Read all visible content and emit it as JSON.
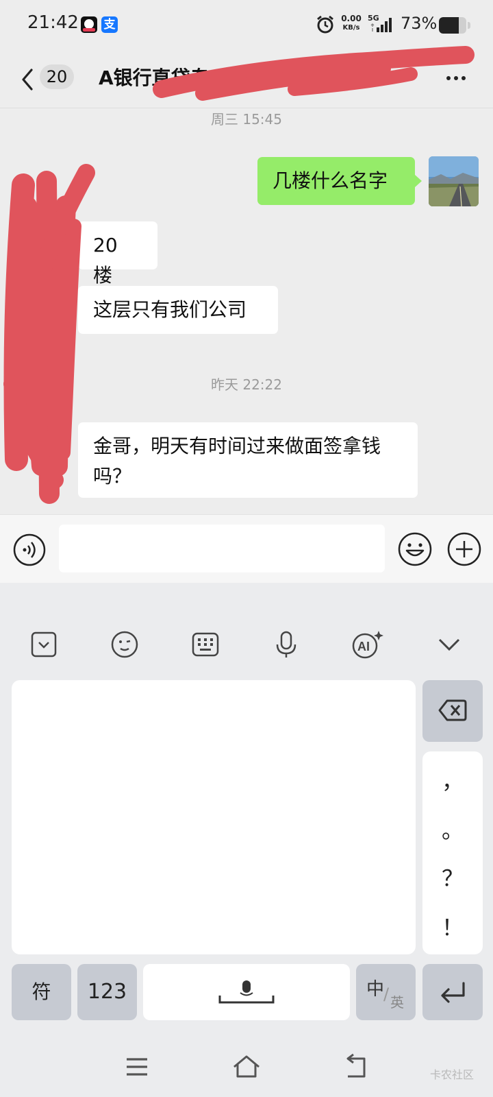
{
  "status_bar": {
    "time": "21:42",
    "alipay_icon_char": "支",
    "net_speed": "0.00",
    "net_unit": "KB/s",
    "network_type": "5G",
    "battery_percent": "73%",
    "battery_level": 0.73
  },
  "header": {
    "unread_count": "20",
    "title": "A银行直贷专"
  },
  "messages": [
    {
      "type": "timestamp",
      "text": "周三 15:45"
    },
    {
      "type": "outgoing",
      "text": "几楼什么名字"
    },
    {
      "type": "incoming",
      "text": "20 楼"
    },
    {
      "type": "incoming",
      "text": "这层只有我们公司"
    },
    {
      "type": "timestamp",
      "text": "昨天 22:22"
    },
    {
      "type": "incoming",
      "text": "金哥，明天有时间过来做面签拿钱吗？"
    }
  ],
  "input": {
    "value": "",
    "placeholder": ""
  },
  "keyboard": {
    "punctuation": [
      "，",
      "。",
      "？",
      "！"
    ],
    "symbol_key": "符",
    "number_key": "123",
    "lang_primary": "中",
    "lang_secondary": "英"
  },
  "watermark": "卡农社区",
  "colors": {
    "outgoing_bubble": "#95ec69",
    "incoming_bubble": "#ffffff",
    "chat_background": "#ededed",
    "scribble": "#e0545c"
  }
}
